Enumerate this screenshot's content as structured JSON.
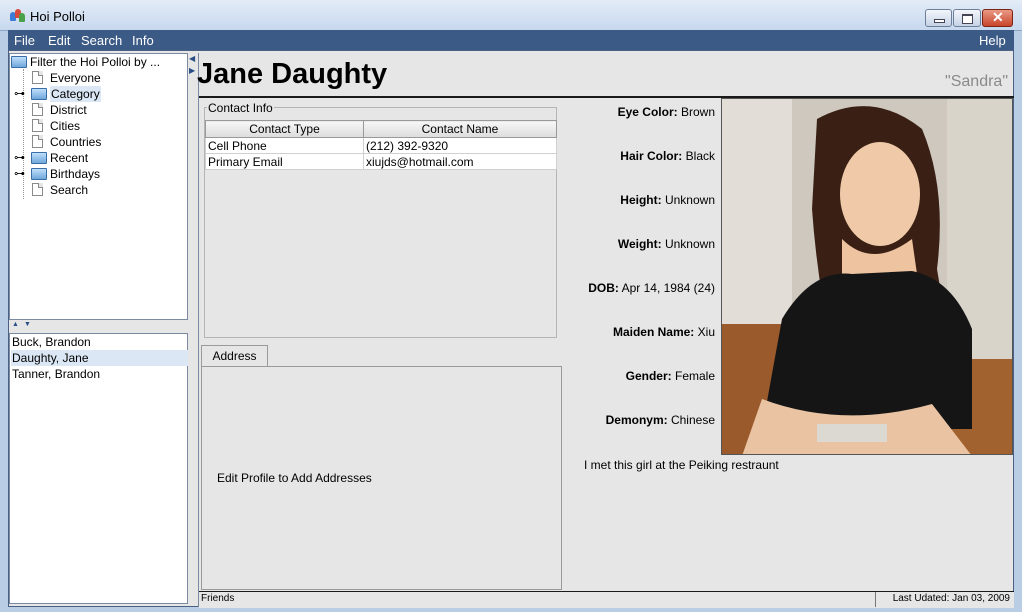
{
  "window": {
    "title": "Hoi Polloi"
  },
  "menu": {
    "file": "File",
    "edit": "Edit",
    "search": "Search",
    "info": "Info",
    "help": "Help"
  },
  "tree": {
    "root": "Filter the Hoi Polloi by ...",
    "items": [
      "Everyone",
      "Category",
      "District",
      "Cities",
      "Countries",
      "Recent",
      "Birthdays",
      "Search"
    ]
  },
  "people": [
    "Buck, Brandon",
    "Daughty, Jane",
    "Tanner, Brandon"
  ],
  "profile": {
    "name": "Jane Daughty",
    "nickname": "\"Sandra\"",
    "note": "I met this girl at the Peiking restraunt"
  },
  "contact": {
    "legend": "Contact Info",
    "headers": [
      "Contact Type",
      "Contact Name"
    ],
    "rows": [
      [
        "Cell Phone",
        "(212) 392-9320"
      ],
      [
        "Primary Email",
        "xiujds@hotmail.com"
      ]
    ]
  },
  "address": {
    "tab": "Address",
    "hint": "Edit Profile to Add Addresses"
  },
  "attributes": [
    {
      "label": "Eye Color:",
      "value": "Brown"
    },
    {
      "label": "Hair Color:",
      "value": "Black"
    },
    {
      "label": "Height:",
      "value": "Unknown"
    },
    {
      "label": "Weight:",
      "value": "Unknown"
    },
    {
      "label": "DOB:",
      "value": "Apr 14, 1984 (24)"
    },
    {
      "label": "Maiden Name:",
      "value": "Xiu"
    },
    {
      "label": "Gender:",
      "value": "Female"
    },
    {
      "label": "Demonym:",
      "value": "Chinese"
    }
  ],
  "status": {
    "left": "Friends",
    "right": "Last Udated: Jan 03, 2009"
  },
  "colors": {
    "menubar": "#3b5a86",
    "selection": "#dbe7f5",
    "panel": "#e6e6e6"
  }
}
